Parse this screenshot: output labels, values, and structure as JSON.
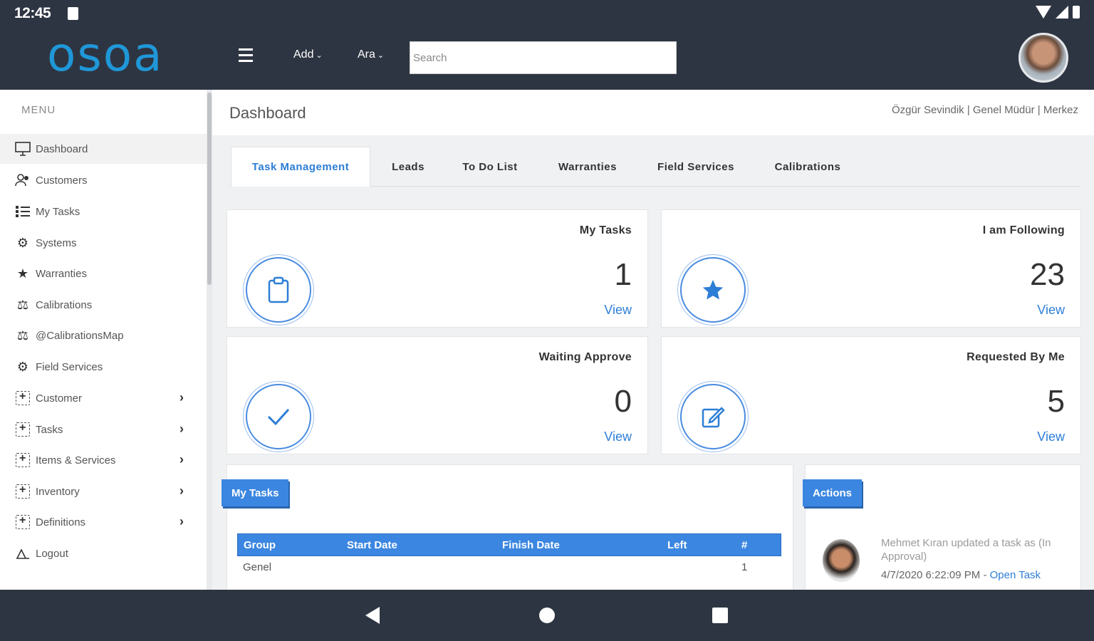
{
  "status": {
    "time": "12:45"
  },
  "app": {
    "logo": "osoa"
  },
  "topnav": {
    "add_label": "Add",
    "ara_label": "Ara",
    "search_placeholder": "Search"
  },
  "sidebar": {
    "menu_title": "MENU",
    "items": [
      {
        "label": "Dashboard",
        "icon": "monitor-icon"
      },
      {
        "label": "Customers",
        "icon": "users-icon"
      },
      {
        "label": "My Tasks",
        "icon": "list-icon"
      },
      {
        "label": "Systems",
        "icon": "gear-icon"
      },
      {
        "label": "Warranties",
        "icon": "star-icon"
      },
      {
        "label": "Calibrations",
        "icon": "scale-icon"
      },
      {
        "label": "@CalibrationsMap",
        "icon": "scale-icon"
      },
      {
        "label": "Field Services",
        "icon": "cogs-icon"
      },
      {
        "label": "Customer",
        "icon": "plus-box-icon"
      },
      {
        "label": "Tasks",
        "icon": "plus-box-icon"
      },
      {
        "label": "Items & Services",
        "icon": "plus-box-icon"
      },
      {
        "label": "Inventory",
        "icon": "plus-box-icon"
      },
      {
        "label": "Definitions",
        "icon": "plus-box-icon"
      },
      {
        "label": "Logout",
        "icon": "logout-icon"
      }
    ]
  },
  "header": {
    "title": "Dashboard",
    "user_info": "Özgür Sevindik | Genel Müdür | Merkez"
  },
  "tabs": [
    "Task Management",
    "Leads",
    "To Do List",
    "Warranties",
    "Field Services",
    "Calibrations"
  ],
  "cards": [
    {
      "title": "My Tasks",
      "value": "1",
      "link": "View",
      "icon": "clipboard-icon"
    },
    {
      "title": "I am Following",
      "value": "23",
      "link": "View",
      "icon": "star-icon"
    },
    {
      "title": "Waiting Approve",
      "value": "0",
      "link": "View",
      "icon": "check-icon"
    },
    {
      "title": "Requested By Me",
      "value": "5",
      "link": "View",
      "icon": "edit-icon"
    }
  ],
  "my_tasks_panel": {
    "ribbon": "My Tasks",
    "columns": [
      "Group",
      "Start Date",
      "Finish Date",
      "Left",
      "#"
    ],
    "rows": [
      {
        "group": "Genel",
        "start": "",
        "finish": "",
        "left": "",
        "count": "1"
      }
    ]
  },
  "actions_panel": {
    "ribbon": "Actions",
    "entry_text": "Mehmet Kıran updated a task as (In Approval)",
    "entry_time": "4/7/2020 6:22:09 PM - ",
    "entry_link": "Open Task"
  },
  "colors": {
    "topbar": "#2e3542",
    "accent": "#2d7ed6",
    "logo": "#1f97d8"
  }
}
